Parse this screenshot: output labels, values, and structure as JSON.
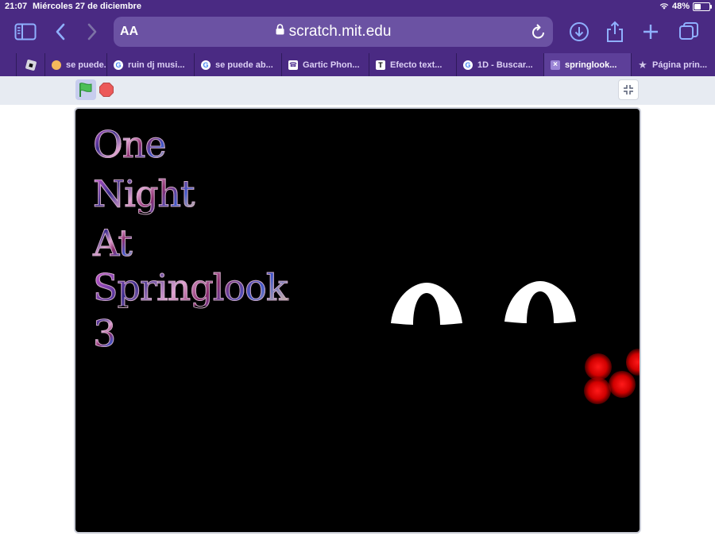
{
  "status_bar": {
    "time": "21:07",
    "date": "Miércoles 27 de diciembre",
    "battery": "48%"
  },
  "toolbar": {
    "text_size_label": "AA",
    "url": "scratch.mit.edu",
    "icons": [
      "sidebar-icon",
      "back-icon",
      "forward-icon",
      "download-icon",
      "share-icon",
      "new-tab-icon",
      "tab-overview-icon"
    ]
  },
  "tabs": [
    {
      "label": "",
      "icon": "roblox-icon"
    },
    {
      "label": "se puede...",
      "icon": "yellow-icon"
    },
    {
      "label": "ruin dj musi...",
      "icon": "google-icon"
    },
    {
      "label": "se puede ab...",
      "icon": "google-icon"
    },
    {
      "label": "Gartic Phon...",
      "icon": "gartic-icon"
    },
    {
      "label": "Efecto text...",
      "icon": "t-icon"
    },
    {
      "label": "1D - Buscar...",
      "icon": "google-icon"
    },
    {
      "label": "springlook...",
      "icon": "scratch-icon"
    },
    {
      "label": "Página prin...",
      "icon": "star-icon"
    }
  ],
  "stage": {
    "title_lines": [
      "One",
      "Night",
      "At",
      "Springlook",
      "3"
    ]
  },
  "colors": {
    "chrome": "#4a2a83",
    "url_bar": "#6b52a3",
    "active_tab": "#5d3f99",
    "toolbar_icon": "#8fb0ff",
    "stage_bg": "#000000",
    "stop": "#ec5959",
    "flag": "#4cbf56",
    "glow_red": "#ff1a1a"
  }
}
